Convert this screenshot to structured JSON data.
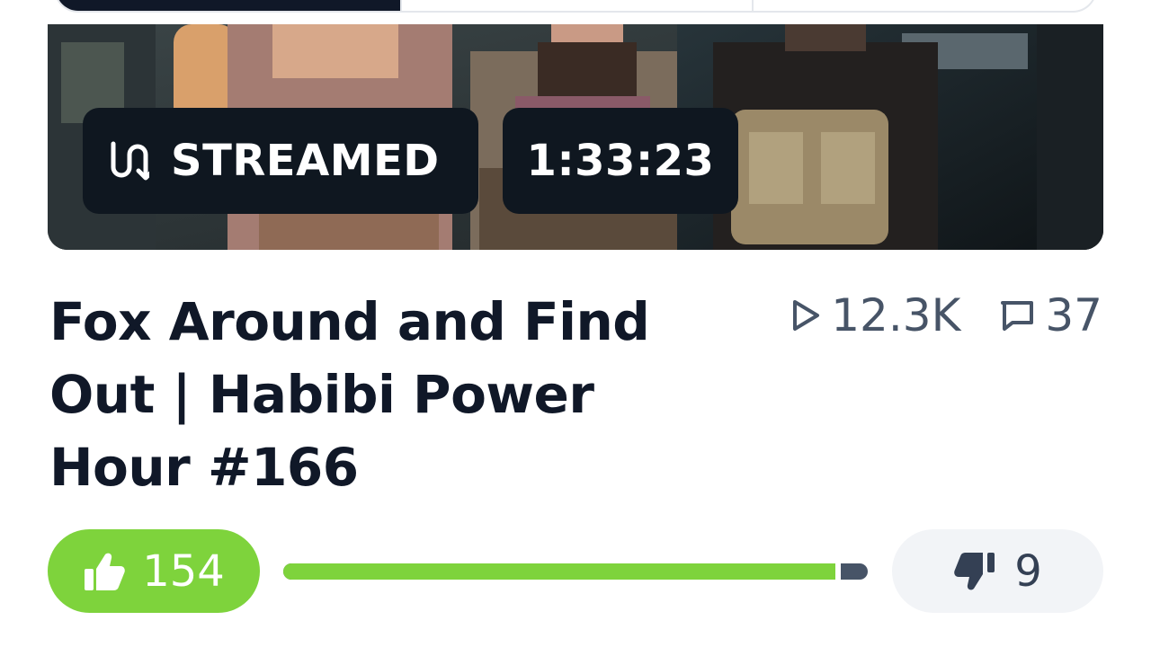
{
  "video": {
    "status_badge": "STREAMED",
    "duration": "1:33:23",
    "title": "Fox Around and Find Out | Habibi Power Hour #166",
    "views": "12.3K",
    "comments": "37"
  },
  "reactions": {
    "likes": "154",
    "dislikes": "9",
    "like_ratio": 0.945,
    "like_color": "#7ed33c",
    "dislike_color": "#475467"
  },
  "icons": {
    "stream": "stream-icon",
    "views": "play-icon",
    "comments": "comment-icon",
    "like": "thumbs-up-icon",
    "dislike": "thumbs-down-icon"
  }
}
